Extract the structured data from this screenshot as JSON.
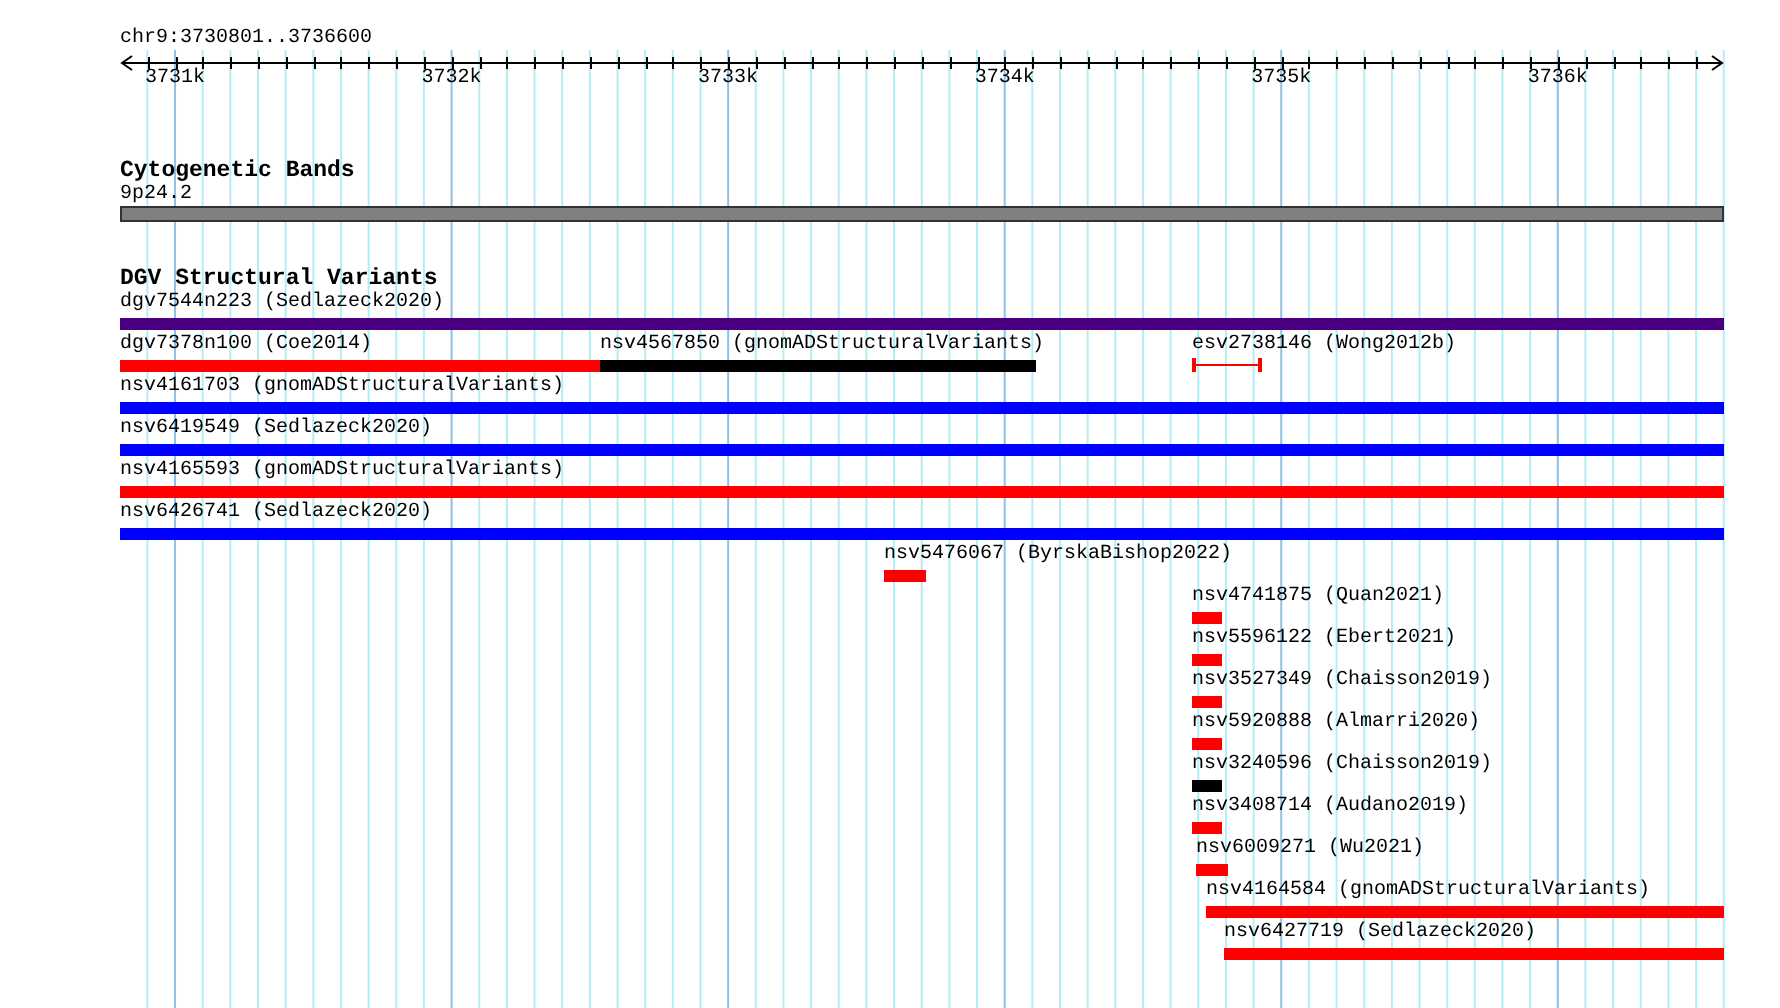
{
  "region": "chr9:3730801..3736600",
  "ruler": {
    "labels": [
      "3731k",
      "3732k",
      "3733k",
      "3734k",
      "3735k",
      "3736k"
    ]
  },
  "tracks": [
    {
      "title": "Cytogenetic Bands",
      "rows": [
        [
          {
            "label": "9p24.2",
            "kind": "band",
            "color": "#808080"
          }
        ]
      ]
    },
    {
      "title": "DGV Structural Variants",
      "rows": [
        [
          {
            "label": "dgv7544n223 (Sedlazeck2020)",
            "kind": "bar",
            "color": "#4b0082"
          }
        ],
        [
          {
            "label": "dgv7378n100 (Coe2014)",
            "kind": "bar",
            "color": "#ff0000"
          },
          {
            "label": "nsv4567850 (gnomADStructuralVariants)",
            "kind": "bar",
            "color": "#000000"
          },
          {
            "label": "esv2738146 (Wong2012b)",
            "kind": "interval",
            "color": "#ff0000"
          }
        ],
        [
          {
            "label": "nsv4161703 (gnomADStructuralVariants)",
            "kind": "bar",
            "color": "#0000ff"
          }
        ],
        [
          {
            "label": "nsv6419549 (Sedlazeck2020)",
            "kind": "bar",
            "color": "#0000ff"
          }
        ],
        [
          {
            "label": "nsv4165593 (gnomADStructuralVariants)",
            "kind": "bar",
            "color": "#ff0000"
          }
        ],
        [
          {
            "label": "nsv6426741 (Sedlazeck2020)",
            "kind": "bar",
            "color": "#0000ff"
          }
        ],
        [
          {
            "label": "nsv5476067 (ByrskaBishop2022)",
            "kind": "bar",
            "color": "#ff0000"
          }
        ],
        [
          {
            "label": "nsv4741875 (Quan2021)",
            "kind": "bar",
            "color": "#ff0000"
          }
        ],
        [
          {
            "label": "nsv5596122 (Ebert2021)",
            "kind": "bar",
            "color": "#ff0000"
          }
        ],
        [
          {
            "label": "nsv3527349 (Chaisson2019)",
            "kind": "bar",
            "color": "#ff0000"
          }
        ],
        [
          {
            "label": "nsv5920888 (Almarri2020)",
            "kind": "bar",
            "color": "#ff0000"
          }
        ],
        [
          {
            "label": "nsv3240596 (Chaisson2019)",
            "kind": "bar",
            "color": "#000000"
          }
        ],
        [
          {
            "label": "nsv3408714 (Audano2019)",
            "kind": "bar",
            "color": "#ff0000"
          }
        ],
        [
          {
            "label": "nsv6009271 (Wu2021)",
            "kind": "bar",
            "color": "#ff0000"
          }
        ],
        [
          {
            "label": "nsv4164584 (gnomADStructuralVariants)",
            "kind": "bar",
            "color": "#ff0000"
          }
        ],
        [
          {
            "label": "nsv6427719 (Sedlazeck2020)",
            "kind": "bar",
            "color": "#ff0000"
          }
        ]
      ]
    }
  ]
}
